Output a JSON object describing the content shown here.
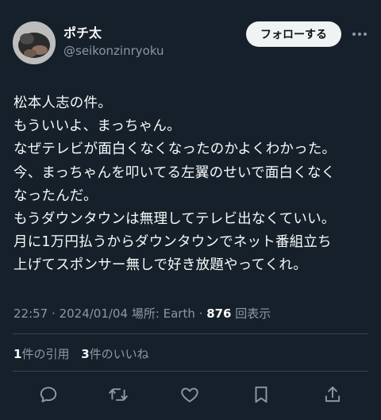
{
  "author": {
    "display_name": "ポチ太",
    "handle": "@seikonzinryoku",
    "avatar_icon": "user-avatar"
  },
  "follow_button": {
    "label": "フォローする"
  },
  "more_icon": "more-horizontal-icon",
  "tweet": {
    "text": "松本人志の件。\nもういいよ、まっちゃん。\nなぜテレビが面白くなくなったのかよくわかった。\n今、まっちゃんを叩いてる左翼のせいで面白くなく\nなったんだ。\nもうダウンタウンは無理してテレビ出なくていい。\n月に1万円払うからダウンタウンでネット番組立ち\n上げてスポンサー無しで好き放題やってくれ。"
  },
  "meta": {
    "time": "22:57",
    "date": "2024/01/04",
    "location_label": "場所: Earth",
    "views_count": "876",
    "views_label": "回表示"
  },
  "stats": {
    "quotes_count": "1",
    "quotes_label": "件の引用",
    "likes_count": "3",
    "likes_label": "件のいいね"
  },
  "actions": [
    {
      "name": "reply",
      "icon": "reply-icon"
    },
    {
      "name": "retweet",
      "icon": "retweet-icon"
    },
    {
      "name": "like",
      "icon": "heart-icon"
    },
    {
      "name": "bookmark",
      "icon": "bookmark-icon"
    },
    {
      "name": "share",
      "icon": "share-icon"
    }
  ],
  "colors": {
    "background": "#15202b",
    "text_primary": "#f7f9f9",
    "text_secondary": "#8b98a5",
    "divider": "#38444d",
    "button_bg": "#eff3f4"
  }
}
